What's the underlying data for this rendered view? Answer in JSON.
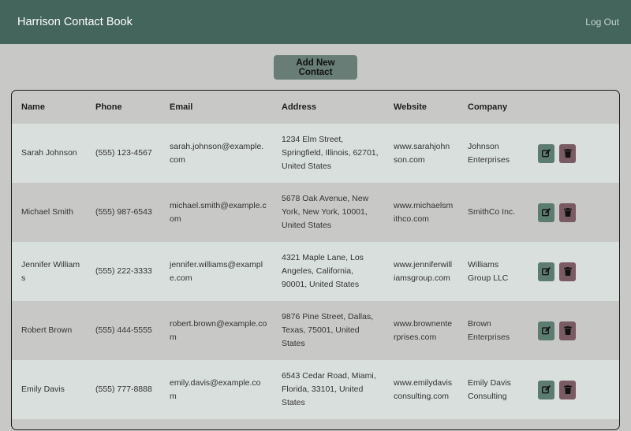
{
  "app": {
    "title": "Harrison Contact Book",
    "logout_label": "Log Out"
  },
  "toolbar": {
    "add_label": "Add New Contact"
  },
  "table": {
    "headers": [
      "Name",
      "Phone",
      "Email",
      "Address",
      "Website",
      "Company"
    ],
    "rows": [
      {
        "name": "Sarah Johnson",
        "phone": "(555) 123-4567",
        "email": "sarah.johnson@example.com",
        "address": "1234 Elm Street, Springfield, Illinois, 62701, United States",
        "website": "www.sarahjohnson.com",
        "company": "Johnson Enterprises"
      },
      {
        "name": "Michael Smith",
        "phone": "(555) 987-6543",
        "email": "michael.smith@example.com",
        "address": "5678 Oak Avenue, New York, New York, 10001, United States",
        "website": "www.michaelsmithco.com",
        "company": "SmithCo Inc."
      },
      {
        "name": "Jennifer Williams",
        "phone": "(555) 222-3333",
        "email": "jennifer.williams@example.com",
        "address": "4321 Maple Lane, Los Angeles, California, 90001, United States",
        "website": "www.jenniferwilliamsgroup.com",
        "company": "Williams Group LLC"
      },
      {
        "name": "Robert Brown",
        "phone": "(555) 444-5555",
        "email": "robert.brown@example.com",
        "address": "9876 Pine Street, Dallas, Texas, 75001, United States",
        "website": "www.brownenterprises.com",
        "company": "Brown Enterprises"
      },
      {
        "name": "Emily Davis",
        "phone": "(555) 777-8888",
        "email": "emily.davis@example.com",
        "address": "6543 Cedar Road, Miami, Florida, 33101, United States",
        "website": "www.emilydavisconsulting.com",
        "company": "Emily Davis Consulting"
      }
    ]
  },
  "icons": {
    "edit": "edit-icon",
    "delete": "trash-icon"
  },
  "colors": {
    "navbar": "#44655c",
    "edit": "#5c7c72",
    "delete": "#7a5a63"
  }
}
